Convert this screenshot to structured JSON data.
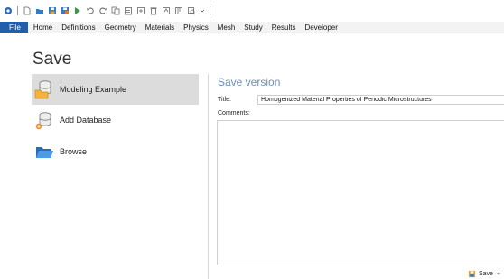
{
  "toolbar": {
    "icons": [
      "app-logo-icon",
      "new-file-icon",
      "open-folder-icon",
      "save-icon",
      "save-as-icon",
      "run-icon",
      "undo-icon",
      "redo-icon",
      "copy-icon",
      "paste-icon",
      "duplicate-icon",
      "delete-icon",
      "build-all-icon",
      "compute-icon",
      "zoom-icon"
    ]
  },
  "ribbon": {
    "tabs": [
      "File",
      "Home",
      "Definitions",
      "Geometry",
      "Materials",
      "Physics",
      "Mesh",
      "Study",
      "Results",
      "Developer"
    ]
  },
  "page": {
    "title": "Save"
  },
  "sidebar": {
    "items": [
      {
        "label": "Modeling Example",
        "icon": "database-folder-icon",
        "selected": true
      },
      {
        "label": "Add Database",
        "icon": "database-add-icon",
        "selected": false
      },
      {
        "label": "Browse",
        "icon": "folder-open-icon",
        "selected": false
      }
    ]
  },
  "form": {
    "section_title": "Save version",
    "title_label": "Title:",
    "title_value": "Homogenized Material Properties of Periodic Microstructures",
    "comments_label": "Comments:",
    "comments_value": ""
  },
  "footer": {
    "save_label": "Save"
  },
  "colors": {
    "file_tab": "#1f5fae",
    "section_title": "#6f8fb5",
    "selected_item": "#dcdcdc"
  }
}
